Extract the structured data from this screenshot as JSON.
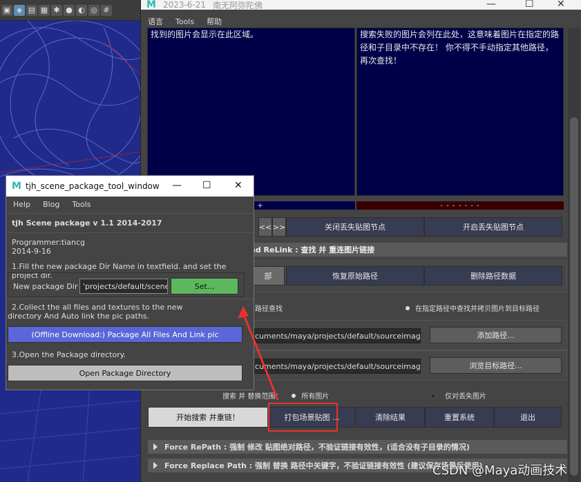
{
  "viewport": {
    "toolbar_icons": [
      "cube-icon",
      "wireframe-icon",
      "shaded-icon",
      "checker-icon",
      "light-icon",
      "sphere-icon",
      "camera-icon",
      "isolate-icon",
      "grid-icon"
    ]
  },
  "relink_window": {
    "title_date": "2023-6-21",
    "title_text": "南无阿弥陀佛",
    "menu": [
      "语言",
      "Tools",
      "帮助"
    ],
    "found_pane_text": "找到的图片会显示在此区域。",
    "missing_pane_text": "搜索失败的图片会列在此处，这意味着图片在指定的路径和子目录中不存在！ 你不得不手动指定其他路径，再次查找！",
    "found_bar": "+ + +",
    "missing_bar": "- - - - - - -",
    "nav_prev": "<<",
    "nav_next": ">>",
    "close_missing_nodes": "关闭丢失贴图节点",
    "open_missing_nodes": "开启丢失贴图节点",
    "section_title": "nd  ReLink : 查找 并 重连图片链接",
    "btn_all": "部",
    "btn_restore_path": "恢复原始路径",
    "btn_delete_path_data": "删除路径数据",
    "radio_path_search": "路径查找",
    "radio_copy_to_target": "在指定路径中查找并拷贝图片到目标路径",
    "path_field_value": "cuments/maya/projects/default/sourceimages,",
    "btn_add_path": "添加路径...",
    "target_field_value": "cuments/maya/projects/default/sourceimages/",
    "btn_browse_target": "浏览目标路径...",
    "search_scope_label": "搜索 并 替换范围：",
    "scope_all": "所有图片",
    "scope_missing": "仅对丢失图片",
    "btn_start_search": "开始搜索 并重链！",
    "btn_pack": "打包场景贴图 ...",
    "btn_clear": "清除结果",
    "btn_reset": "重置系统",
    "btn_exit": "退出",
    "force_repath": "Force RePath : 强制 修改 贴图绝对路径，不验证链接有效性，(适合没有子目录的情况)",
    "force_replace": "Force Replace Path : 强制 替换 路径中关键字，不验证链接有效性 (建议保存场景后使用)"
  },
  "tool_window": {
    "title": "tjh_scene_package_tool_window",
    "menu": [
      "Help",
      "Blog",
      "Tools"
    ],
    "header": "tjh  Scene  package  v 1.1  2014-2017",
    "programmer": "Programmer:tiancg",
    "date": "2014-9-16",
    "step1": "1.Fill the new package Dir Name in textfield. and set the project dir.",
    "new_package_label": "New package Dir :",
    "new_package_value": "'projects/default/scenes",
    "set_button": "Set...",
    "step2_line1": "2.Collect the all files and textures to the new",
    "step2_line2": "directory And Auto link the pic paths.",
    "package_button": "(Offline Download:)  Package  All  Files  And Link pic",
    "step3": "3.Open the Package directory.",
    "open_dir_button": "Open  Package  Directory"
  },
  "watermark": "CSDN @Maya动画技术",
  "colors": {
    "accent_green": "#5cb85c",
    "accent_blue": "#5b67d6",
    "annotation_red": "#e8322c"
  }
}
